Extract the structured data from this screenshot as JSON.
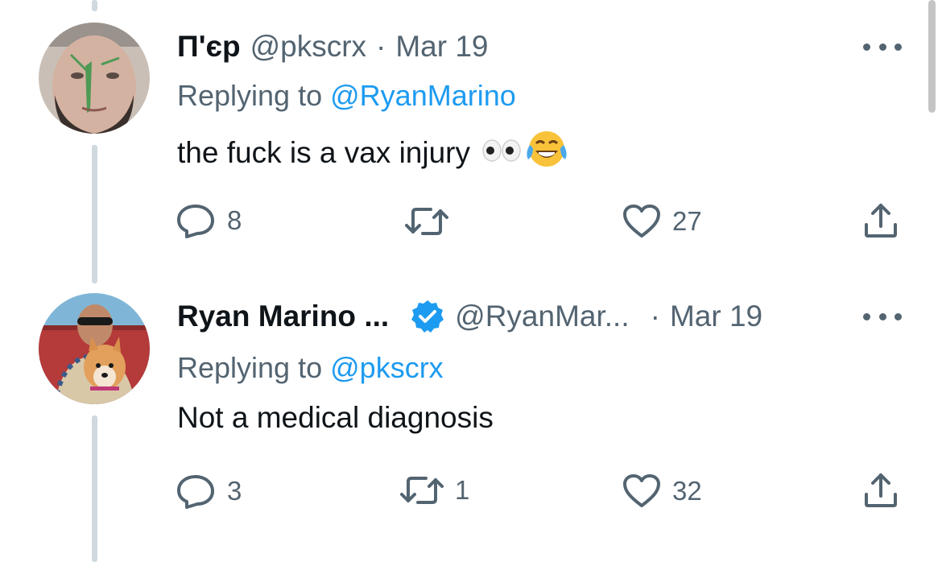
{
  "tweets": [
    {
      "name": "Π'єр",
      "handle": "@pkscrx",
      "separator": "·",
      "date": "Mar 19",
      "replying_prefix": "Replying to",
      "replying_to": "@RyanMarino",
      "text": "the fuck is a vax injury",
      "emoji": [
        "eyes-emoji",
        "tears-of-joy-emoji"
      ],
      "verified": false,
      "actions": {
        "reply_count": "8",
        "retweet_count": "",
        "like_count": "27"
      }
    },
    {
      "name": "Ryan Marino ...",
      "handle": "@RyanMar...",
      "separator": "·",
      "date": "Mar 19",
      "replying_prefix": "Replying to",
      "replying_to": "@pkscrx",
      "text": "Not a medical diagnosis",
      "verified": true,
      "actions": {
        "reply_count": "3",
        "retweet_count": "1",
        "like_count": "32"
      }
    }
  ],
  "colors": {
    "text": "#0f1419",
    "secondary": "#536471",
    "accent": "#1d9bf0",
    "thread_line": "#cfd9de"
  },
  "icons": [
    "reply-icon",
    "retweet-icon",
    "like-icon",
    "share-icon",
    "more-icon",
    "verified-badge-icon"
  ]
}
